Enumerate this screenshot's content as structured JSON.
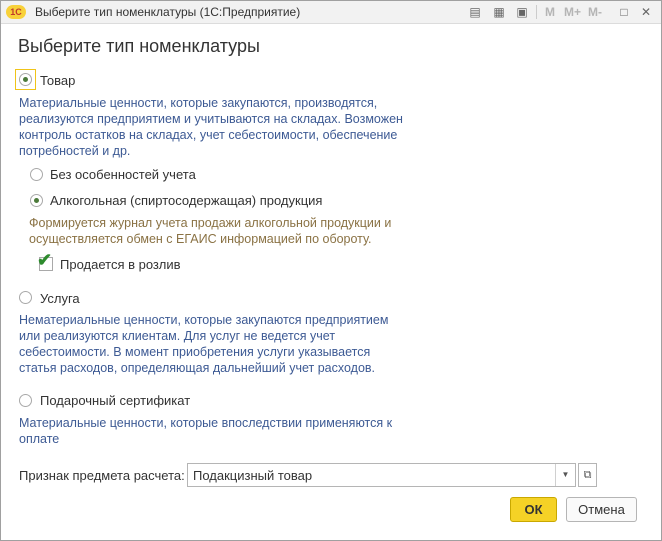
{
  "window": {
    "title": "Выберите тип номенклатуры  (1С:Предприятие)",
    "logo_text": "1С",
    "toolbar": {
      "m": "M",
      "m_plus": "M+",
      "m_minus": "M-"
    }
  },
  "heading": "Выберите тип номенклатуры",
  "options": {
    "tovar": {
      "label": "Товар",
      "selected": true,
      "description": "Материальные ценности, которые закупаются, производятся, реализуются предприятием и учитываются на складах. Возможен контроль остатков на складах, учет себестоимости, обеспечение потребностей и др.",
      "suboptions": {
        "plain": {
          "label": "Без особенностей учета",
          "selected": false
        },
        "alcohol": {
          "label": "Алкогольная (спиртосодержащая) продукция",
          "selected": true,
          "description": "Формируется журнал учета продажи алкогольной продукции и осуществляется обмен с ЕГАИС информацией по обороту.",
          "draft": {
            "label": "Продается в розлив",
            "checked": true
          }
        }
      }
    },
    "usluga": {
      "label": "Услуга",
      "selected": false,
      "description": "Нематериальные ценности, которые закупаются предприятием или реализуются клиентам. Для услуг не ведется учет себестоимости. В момент приобретения услуги указывается статья расходов, определяющая дальнейший учет расходов."
    },
    "certificate": {
      "label": "Подарочный сертификат",
      "selected": false,
      "description": "Материальные ценности, которые впоследствии применяются к оплате"
    }
  },
  "payment_subject": {
    "label": "Признак предмета расчета:",
    "value": "Подакцизный товар"
  },
  "buttons": {
    "ok": "ОК",
    "cancel": "Отмена"
  },
  "colors": {
    "accent": "#f5d226",
    "description": "#3d5a94",
    "alcohol_description": "#8a7244",
    "check": "#2e8b2e"
  }
}
